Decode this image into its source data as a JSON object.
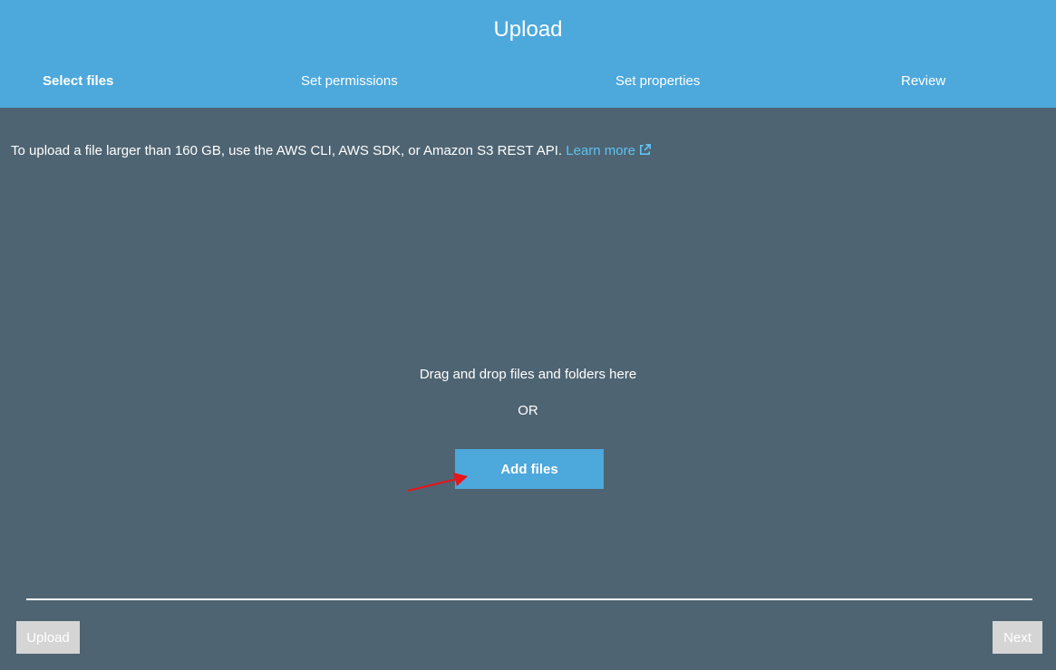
{
  "dialog": {
    "title": "Upload"
  },
  "steps": [
    {
      "label": "Select files",
      "active": true
    },
    {
      "label": "Set permissions",
      "active": false
    },
    {
      "label": "Set properties",
      "active": false
    },
    {
      "label": "Review",
      "active": false
    }
  ],
  "notice": {
    "text": "To upload a file larger than 160 GB, use the AWS CLI, AWS SDK, or Amazon S3 REST API.",
    "link_label": "Learn more",
    "link_icon": "external-link-icon"
  },
  "dropzone": {
    "instruction": "Drag and drop files and folders here",
    "or_label": "OR",
    "add_button_label": "Add files"
  },
  "annotation": {
    "icon": "red-arrow-icon",
    "color": "#e8141b"
  },
  "footer": {
    "upload_label": "Upload",
    "next_label": "Next"
  },
  "colors": {
    "header": "#4da8dc",
    "background": "#4e6472",
    "link": "#5ec2f2",
    "disabled_button": "#d5d5d5"
  }
}
